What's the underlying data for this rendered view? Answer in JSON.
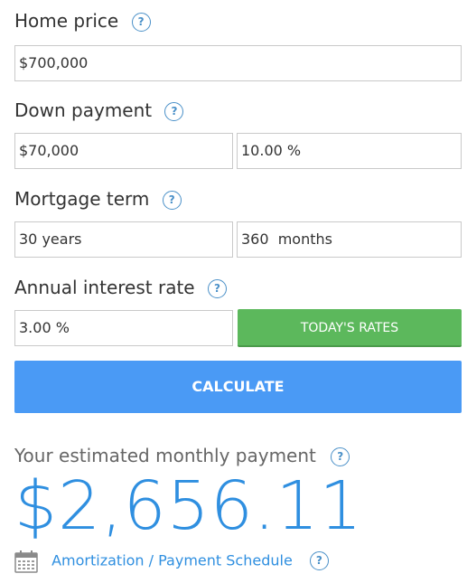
{
  "home_price": {
    "label": "Home price",
    "help": "?",
    "value": "$700,000"
  },
  "down_payment": {
    "label": "Down payment",
    "help": "?",
    "amount_value": "$70,000",
    "percent_value": "10.00 %"
  },
  "mortgage_term": {
    "label": "Mortgage term",
    "help": "?",
    "years_value": "30 years",
    "months_value": "360  months"
  },
  "interest_rate": {
    "label": "Annual interest rate",
    "help": "?",
    "rate_value": "3.00 %",
    "todays_rates_label": "TODAY'S RATES"
  },
  "calculate_label": "CALCULATE",
  "result": {
    "label": "Your estimated monthly payment",
    "help": "?",
    "amount": "$2,656.11"
  },
  "amortization": {
    "link_label": "Amortization / Payment Schedule",
    "help": "?",
    "icon": "calendar-icon"
  },
  "colors": {
    "accent_blue": "#2f8fe0",
    "calculate_button": "#4a9af5",
    "rates_button": "#5cb85c",
    "help_icon": "#4a90c8"
  }
}
